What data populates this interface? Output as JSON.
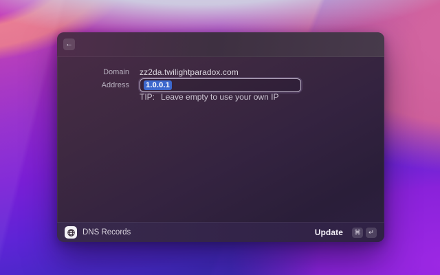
{
  "window": {
    "titlebar": {
      "back_icon": "←"
    },
    "form": {
      "domain_label": "Domain",
      "domain_value": "zz2da.twilightparadox.com",
      "address_label": "Address",
      "address_value": "1.0.0.1",
      "tip_label": "TIP:",
      "tip_text": "Leave empty to use your own IP"
    },
    "footer": {
      "app_icon": "globe-icon",
      "app_label": "DNS Records",
      "action_label": "Update",
      "shortcut_keys": [
        "⌘",
        "↵"
      ]
    }
  },
  "colors": {
    "selection_blue": "#3c68cd",
    "window_tint": "#3a2940",
    "wallpaper_magenta": "#c02cb3",
    "wallpaper_pink": "#ce5f9b",
    "wallpaper_violet": "#7b1fd6",
    "wallpaper_blue": "#2e2596"
  }
}
